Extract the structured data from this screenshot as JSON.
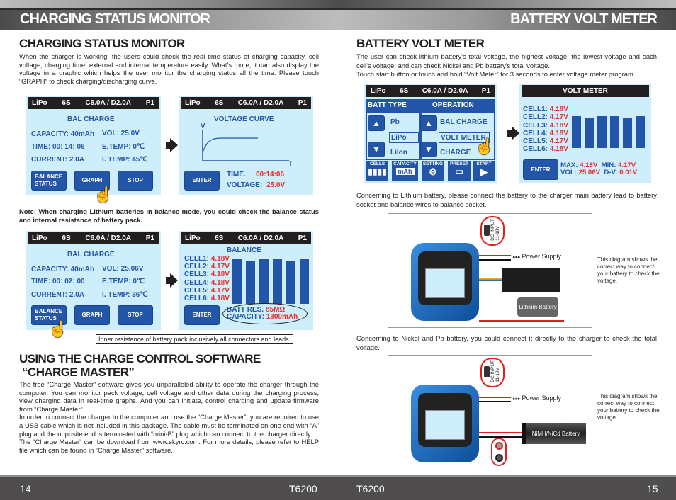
{
  "header": {
    "left_title": "CHARGING STATUS MONITOR",
    "right_title": "BATTERY VOLT METER"
  },
  "left": {
    "heading": "CHARGING STATUS MONITOR",
    "intro": "When the charger is working, the users could check the real time status of charging capacity, cell voltage, charging time, external and internal temperature easily. What's more, it can also display the voltage in a graphic which helps the user monitor the charging status all the time. Please touch “GRAPH” to check charging/discharging curve.",
    "screen_header": {
      "type": "LiPo",
      "cells": "6S",
      "rate": "C6.0A / D2.0A",
      "program": "P1"
    },
    "screen1": {
      "title": "BAL CHARGE",
      "capacity": "CAPACITY: 40mAh",
      "vol": "VOL: 25.0V",
      "time": "TIME: 00: 14: 06",
      "etemp": "E.TEMP: 0℃",
      "current": "CURRENT: 2.0A",
      "itemp": "I. TEMP: 45℃",
      "btn_balance": "BALANCE STATUS",
      "btn_graph": "GRAPH",
      "btn_stop": "STOP"
    },
    "screen2": {
      "title": "VOLTAGE CURVE",
      "axis_v": "V",
      "axis_t": "T",
      "btn_enter": "ENTER",
      "time_label": "TIME.",
      "time_value": "00:14:06",
      "voltage_label": "VOLTAGE:",
      "voltage_value": "25.0V"
    },
    "note": "Note: When charging Lithium batteries in balance mode, you could check the balance status and internal resistance of battery pack.",
    "screen3": {
      "title": "BAL CHARGE",
      "capacity": "CAPACITY: 40mAh",
      "vol": "VOL: 25.06V",
      "time": "TIME: 00: 02: 00",
      "etemp": "E.TEMP: 0℃",
      "current": "CURRENT: 2.0A",
      "itemp": "I. TEMP: 36℃",
      "btn_balance": "BALANCE STATUS",
      "btn_graph": "GRAPH",
      "btn_stop": "STOP"
    },
    "screen4": {
      "title": "BALANCE",
      "cells": [
        {
          "label": "CELL1:",
          "value": "4.18V",
          "v": 4.18
        },
        {
          "label": "CELL2:",
          "value": "4.17V",
          "v": 4.17
        },
        {
          "label": "CELL3:",
          "value": "4.18V",
          "v": 4.18
        },
        {
          "label": "CELL4:",
          "value": "4.18V",
          "v": 4.18
        },
        {
          "label": "CELL5:",
          "value": "4.17V",
          "v": 4.17
        },
        {
          "label": "CELL6:",
          "value": "4.18V",
          "v": 4.18
        }
      ],
      "btn_enter": "ENTER",
      "res_label": "BATT RES.",
      "res_value": "85MΩ",
      "cap_label": "CAPACITY:",
      "cap_value": "1300mAh"
    },
    "callout": "Inner resistance of battery pack inclusively all connectors and leads.",
    "heading2_line1": "USING THE CHARGE CONTROL SOFTWARE",
    "heading2_line2": " “CHARGE MASTER”",
    "body2": [
      "The free “Charge Master” software gives you unparalleled ability to operate the charger through the computer. You can monitor pack voltage, cell voltage and other data during the charging process, view charging data in real-time graphs. And you can initiate, control charging and update firmware from “Charge Master”.",
      "In order to connect the charger to the computer and use the “Charge Master”, you are required to use a USB cable which is not included in this package. The cable must be terminated on one end with  “A” plug and the opposite end is terminated with “mini-B” plug which can connect to the charger directly.",
      "The “Charge Master” can be download from www.skyrc.com. For more details, please refer to HELP file which can be found in “Charge Master” software."
    ]
  },
  "right": {
    "heading": "BATTERY VOLT METER",
    "intro": [
      "The user can check lithium battery's total voltage, the highest voltage, the lowest voltage and each cell's voltage; and can check Nickel and Pb battery's total voltage.",
      "Touch start button or touch and hold “Volt Meter” for 3 seconds to enter voltage meter program."
    ],
    "menu": {
      "batt_type": "BATT TYPE",
      "operation": "OPERATION",
      "types": [
        "Pb",
        "LiPo",
        "LiIon"
      ],
      "ops": [
        "BAL CHARGE",
        "VOLT METER",
        "CHARGE"
      ],
      "tabs": [
        "CELLS",
        "CAPACITY",
        "SETTING",
        "PRESET",
        "START"
      ],
      "mah": "mAh"
    },
    "voltmeter": {
      "title": "VOLT METER",
      "cells": [
        {
          "label": "CELL1:",
          "value": "4.18V",
          "v": 4.18
        },
        {
          "label": "CELL2:",
          "value": "4.17V",
          "v": 4.17
        },
        {
          "label": "CELL3:",
          "value": "4.18V",
          "v": 4.18
        },
        {
          "label": "CELL4:",
          "value": "4.18V",
          "v": 4.18
        },
        {
          "label": "CELL5:",
          "value": "4.17V",
          "v": 4.17
        },
        {
          "label": "CELL6:",
          "value": "4.18V",
          "v": 4.18
        }
      ],
      "btn_enter": "ENTER",
      "max_label": "MAX:",
      "max_value": "4.18V",
      "min_label": "MIN:",
      "min_value": "4.17V",
      "vol_label": "VOL:",
      "vol_value": "25.06V",
      "dv_label": "D-V:",
      "dv_value": "0.01V"
    },
    "para_lithium": "Concerning to Lithium battery, please connect the battery to the charger main battery lead to battery socket and balance wires to balance socket.",
    "diagram1": {
      "dc_input": "DC INPUT",
      "dc_range": "11-18V",
      "power_supply": "Power Supply",
      "battery": "Lithium Battery",
      "caption": "This diagram shows the correct way to connect your battery to check the voltage."
    },
    "para_nickel": "Concerning to Nickel and Pb battery, you could connect it directly to the charger to check the total voltage.",
    "diagram2": {
      "dc_input": "DC INPUT",
      "dc_range": "11-18V",
      "power_supply": "Power Supply",
      "battery": "NiMH/NiCd Battery",
      "caption": "This diagram shows the correct way to connect your battery to check the voltage."
    }
  },
  "footer": {
    "page_left": "14",
    "model_left": "T6200",
    "model_right": "T6200",
    "page_right": "15"
  },
  "colors": {
    "screen_bg": "#cdeefa",
    "screen_text": "#2457a8",
    "value_red": "#ee2a2a",
    "footer": "#4f4d4e"
  }
}
